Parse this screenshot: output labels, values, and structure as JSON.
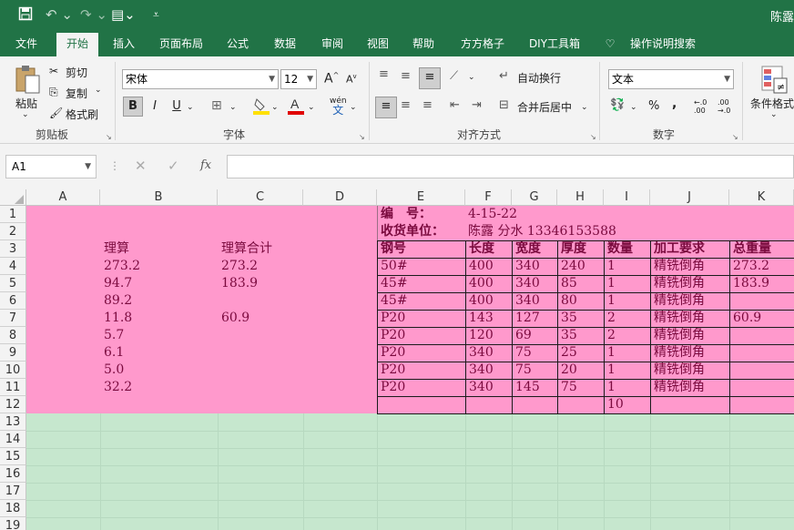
{
  "window": {
    "user_name": "陈露"
  },
  "tabs": [
    "文件",
    "开始",
    "插入",
    "页面布局",
    "公式",
    "数据",
    "审阅",
    "视图",
    "帮助",
    "方方格子",
    "DIY工具箱",
    "操作说明搜索"
  ],
  "ribbon": {
    "clipboard": {
      "paste": "粘贴",
      "cut": "剪切",
      "copy": "复制",
      "format_painter": "格式刷",
      "label": "剪贴板"
    },
    "font": {
      "name": "宋体",
      "size": "12",
      "bold": "B",
      "italic": "I",
      "underline": "U",
      "grow": "A",
      "shrink": "A",
      "label": "字体",
      "wen": "wén",
      "wen2": "文"
    },
    "alignment": {
      "wrap": "自动换行",
      "merge": "合并后居中",
      "label": "对齐方式"
    },
    "number": {
      "format": "文本",
      "percent": "%",
      "comma": ",",
      "inc": ".00",
      "dec": ".0",
      "label": "数字"
    },
    "styles": {
      "cond": "条件格式"
    }
  },
  "formula_bar": {
    "name_box": "A1",
    "fx": "fx",
    "value": ""
  },
  "columns": [
    "A",
    "B",
    "C",
    "D",
    "E",
    "F",
    "G",
    "H",
    "I",
    "J",
    "K"
  ],
  "rows": [
    "1",
    "2",
    "3",
    "4",
    "5",
    "6",
    "7",
    "8",
    "9",
    "10",
    "11",
    "12",
    "13",
    "14",
    "15",
    "16",
    "17",
    "18",
    "19"
  ],
  "colors": {
    "accent": "#217346",
    "pink": "#ff99cc",
    "green": "#c6e7ce",
    "text": "#7a0a3e"
  },
  "sheet": {
    "left": {
      "h1": "理算",
      "h2": "理算合计",
      "b": [
        "273.2",
        "94.7",
        "89.2",
        "11.8",
        "5.7",
        "6.1",
        "5.0",
        "32.2"
      ],
      "c": [
        "273.2",
        "183.9",
        "",
        "60.9",
        "",
        "",
        "",
        ""
      ]
    },
    "info": {
      "code_label": "编　号：",
      "code_value": "4-15-22",
      "recv_label": "收货单位：",
      "recv_value": "陈露 分水 13346153588"
    },
    "table": {
      "headers": [
        "钢号",
        "长度",
        "宽度",
        "厚度",
        "数量",
        "加工要求",
        "总重量"
      ],
      "rows": [
        [
          "50#",
          "400",
          "340",
          "240",
          "1",
          "精铣倒角",
          "273.2"
        ],
        [
          "45#",
          "400",
          "340",
          "85",
          "1",
          "精铣倒角",
          "183.9"
        ],
        [
          "45#",
          "400",
          "340",
          "80",
          "1",
          "精铣倒角",
          ""
        ],
        [
          "P20",
          "143",
          "127",
          "35",
          "2",
          "精铣倒角",
          "60.9"
        ],
        [
          "P20",
          "120",
          "69",
          "35",
          "2",
          "精铣倒角",
          ""
        ],
        [
          "P20",
          "340",
          "75",
          "25",
          "1",
          "精铣倒角",
          ""
        ],
        [
          "P20",
          "340",
          "75",
          "20",
          "1",
          "精铣倒角",
          ""
        ],
        [
          "P20",
          "340",
          "145",
          "75",
          "1",
          "精铣倒角",
          ""
        ]
      ],
      "total": "10"
    }
  }
}
